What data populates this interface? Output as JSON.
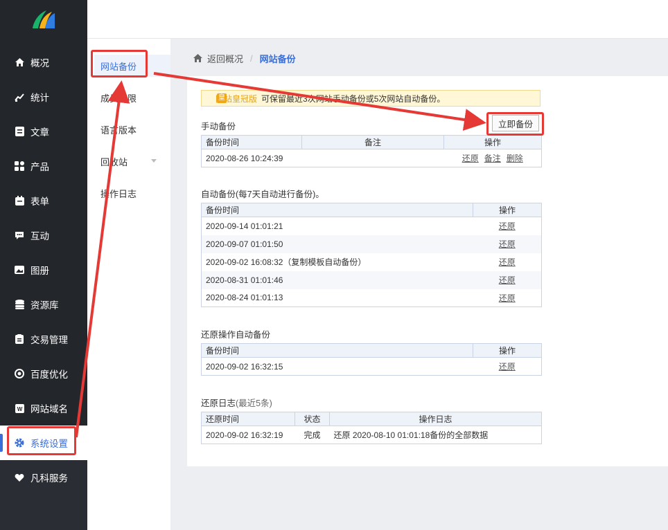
{
  "nav": {
    "items": [
      {
        "label": "概况",
        "icon": "home-icon"
      },
      {
        "label": "统计",
        "icon": "chart-icon"
      },
      {
        "label": "文章",
        "icon": "article-icon"
      },
      {
        "label": "产品",
        "icon": "product-icon"
      },
      {
        "label": "表单",
        "icon": "form-icon"
      },
      {
        "label": "互动",
        "icon": "chat-icon"
      },
      {
        "label": "图册",
        "icon": "gallery-icon"
      },
      {
        "label": "资源库",
        "icon": "database-icon"
      },
      {
        "label": "交易管理",
        "icon": "trade-icon"
      },
      {
        "label": "百度优化",
        "icon": "seo-icon"
      },
      {
        "label": "网站域名",
        "icon": "domain-icon"
      },
      {
        "label": "系统设置",
        "icon": "gear-icon"
      },
      {
        "label": "凡科服务",
        "icon": "heart-icon"
      }
    ],
    "active_index": 11
  },
  "subnav": {
    "items": [
      "网站备份",
      "成员权限",
      "语言版本",
      "回收站",
      "操作日志"
    ],
    "active": "网站备份"
  },
  "breadcrumb": {
    "back": "返回概况",
    "separator": "/",
    "current": "网站备份"
  },
  "notice": {
    "badge": "网站皇冠版",
    "text": "可保留最近3次网站手动备份或5次网站自动备份。"
  },
  "manual": {
    "title": "手动备份",
    "button": "立即备份",
    "headers": [
      "备份时间",
      "备注",
      "操作"
    ],
    "rows": [
      {
        "time": "2020-08-26 10:24:39",
        "note": "",
        "actions": [
          "还原",
          "备注",
          "删除"
        ]
      }
    ]
  },
  "auto": {
    "title": "自动备份(每7天自动进行备份)。",
    "headers": [
      "备份时间",
      "操作"
    ],
    "rows": [
      {
        "time": "2020-09-14 01:01:21",
        "action": "还原"
      },
      {
        "time": "2020-09-07 01:01:50",
        "action": "还原"
      },
      {
        "time": "2020-09-02 16:08:32（复制模板自动备份）",
        "action": "还原"
      },
      {
        "time": "2020-08-31 01:01:46",
        "action": "还原"
      },
      {
        "time": "2020-08-24 01:01:13",
        "action": "还原"
      }
    ]
  },
  "restore_auto": {
    "title": "还原操作自动备份",
    "headers": [
      "备份时间",
      "操作"
    ],
    "rows": [
      {
        "time": "2020-09-02 16:32:15",
        "action": "还原"
      }
    ]
  },
  "restore_log": {
    "title": "还原日志",
    "title_suffix": "(最近5条)",
    "headers": [
      "还原时间",
      "状态",
      "操作日志"
    ],
    "rows": [
      {
        "time": "2020-09-02 16:32:19",
        "status": "完成",
        "log": "还原 2020-08-10 01:01:18备份的全部数据"
      }
    ]
  },
  "colors": {
    "accent": "#3a6fd8",
    "nav_bg": "#23262b",
    "annotation": "#e53935"
  }
}
